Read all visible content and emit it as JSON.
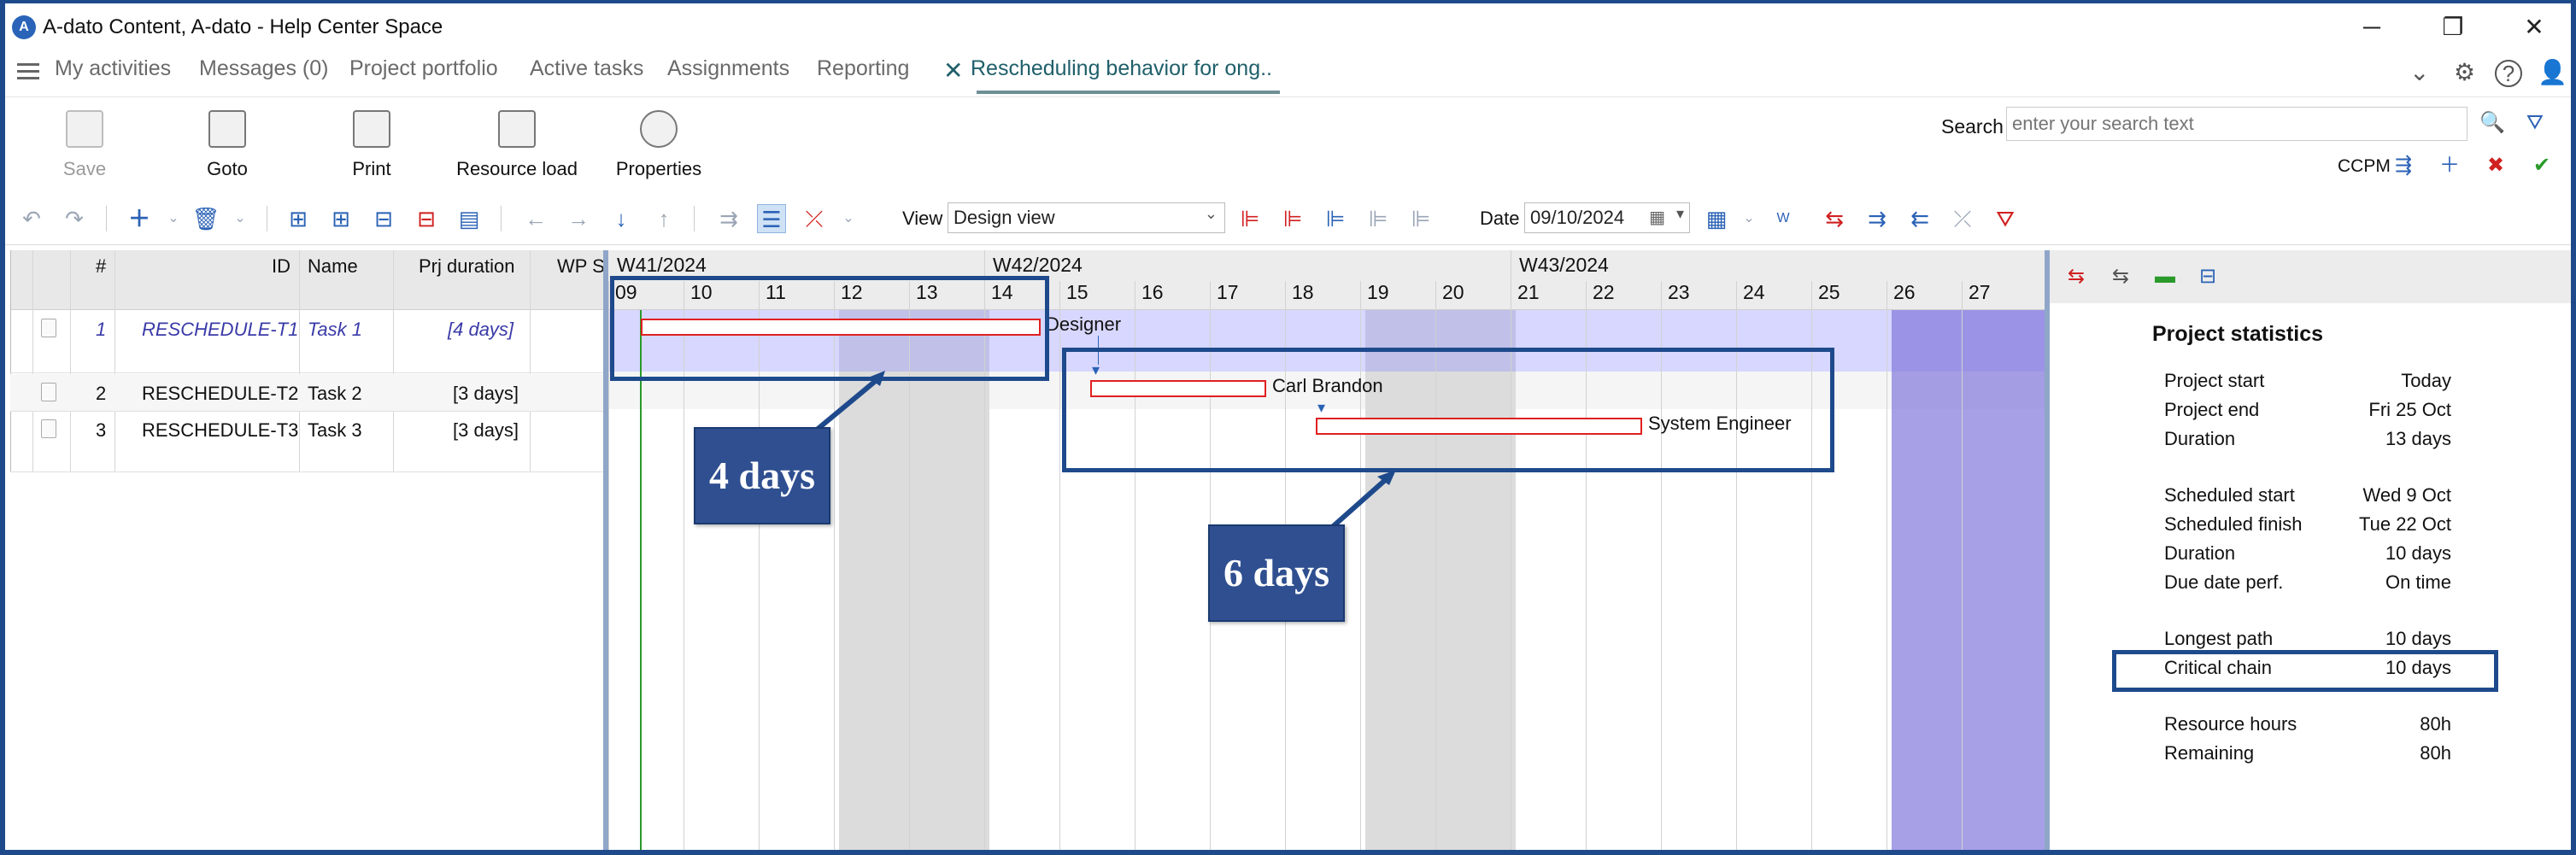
{
  "window": {
    "title": "A-dato Content, A-dato - Help Center Space",
    "minimize": "─",
    "restore": "❐",
    "close": "✕"
  },
  "nav": {
    "items": [
      "My activities",
      "Messages (0)",
      "Project portfolio",
      "Active tasks",
      "Assignments",
      "Reporting"
    ],
    "active_tab": "Rescheduling behavior for ong..",
    "close_glyph": "✕"
  },
  "ribbon": {
    "save": "Save",
    "goto": "Goto",
    "print": "Print",
    "resource_load": "Resource load",
    "properties": "Properties",
    "search_label": "Search",
    "search_placeholder": "enter your search text",
    "ccpm_label": "CCPM"
  },
  "toolbar": {
    "view_label": "View",
    "view_value": "Design view",
    "date_label": "Date",
    "date_value": "09/10/2024"
  },
  "grid": {
    "headers": [
      "#",
      "ID",
      "Name",
      "Prj duration",
      "WP S"
    ],
    "rows": [
      {
        "num": "1",
        "id": "RESCHEDULE-T1",
        "name": "Task 1",
        "duration": "[4 days]"
      },
      {
        "num": "2",
        "id": "RESCHEDULE-T2",
        "name": "Task 2",
        "duration": "[3 days]"
      },
      {
        "num": "3",
        "id": "RESCHEDULE-T3",
        "name": "Task 3",
        "duration": "[3 days]"
      }
    ]
  },
  "gantt": {
    "weeks": [
      "W41/2024",
      "W42/2024",
      "W43/2024"
    ],
    "days": [
      "09",
      "10",
      "11",
      "12",
      "13",
      "14",
      "15",
      "16",
      "17",
      "18",
      "19",
      "20",
      "21",
      "22",
      "23",
      "24",
      "25",
      "26",
      "27"
    ],
    "resources": [
      "Designer",
      "Carl Brandon",
      "System Engineer"
    ]
  },
  "stats": {
    "title": "Project statistics",
    "groups": [
      [
        {
          "label": "Project start",
          "value": "Today"
        },
        {
          "label": "Project end",
          "value": "Fri 25 Oct"
        },
        {
          "label": "Duration",
          "value": "13 days"
        }
      ],
      [
        {
          "label": "Scheduled start",
          "value": "Wed 9 Oct"
        },
        {
          "label": "Scheduled finish",
          "value": "Tue 22 Oct"
        },
        {
          "label": "Duration",
          "value": "10 days"
        },
        {
          "label": "Due date perf.",
          "value": "On time"
        }
      ],
      [
        {
          "label": "Longest path",
          "value": "10 days"
        },
        {
          "label": "Critical chain",
          "value": "10 days"
        }
      ],
      [
        {
          "label": "Resource hours",
          "value": "80h"
        },
        {
          "label": "Remaining",
          "value": "80h"
        }
      ]
    ]
  },
  "callouts": {
    "first": "4 days",
    "second": "6 days"
  },
  "colors": {
    "frame": "#1e4a8c",
    "callout_bg": "#2f4f90",
    "bar_border": "#e02020",
    "row_highlight": "#c8c8ff",
    "deadline_band": "#8a80dc"
  }
}
